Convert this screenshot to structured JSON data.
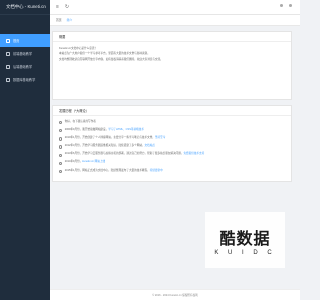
{
  "app": {
    "brand": "文档中心 - Kuneti.cn"
  },
  "sidebar": {
    "items": [
      {
        "label": "首页",
        "active": true
      },
      {
        "label": "前端基础教学"
      },
      {
        "label": "后端基础教学"
      },
      {
        "label": "数据库基础教学"
      }
    ]
  },
  "tabs": {
    "home": "首页",
    "current": "简介"
  },
  "notice": {
    "title": "概要",
    "lines": [
      "Kunetic.cn文档中心是什么意思？",
      "本站点为广大用户提供一个学习参考平台，里面有大量的技术文章与各种资源。",
      "文档均整理收录自互联网开放分享内容，如有侵权请联系我们删除，欢迎大家浏览与交流。"
    ]
  },
  "timeline": {
    "title": "发展历程（*大概论）",
    "items": [
      {
        "text": "你好，在下我认真的写作者",
        "link": ""
      },
      {
        "text": "2009年9月份，我开始接触网站建设，",
        "link": "学习了HTML、CSS等前端技术"
      },
      {
        "text": "2010年1月份，开始创建了个人博客网站，主要分享一些学习笔记与技术文章，",
        "link": "坚持至今"
      },
      {
        "text": "2012年3月份，开始学习服务器运维相关知识，陆续搭建了多个网站，",
        "link": "文档站点"
      },
      {
        "text": "2013年6月份，开始学习云服务器与虚拟主机的部署，通过自己的努力，帮助了很多站长朋友解决问题，",
        "link": "免费提供技术支持"
      },
      {
        "text": "2014年9月份，",
        "link": "kunetic.cn 网站上线"
      },
      {
        "text": "2015年1月份，网站正式成为文档中心，陆续整理发布了大量的技术教程，",
        "link": "持续更新中"
      }
    ]
  },
  "footer": {
    "text": "© 2016 - 2024 Kunetic.cn 保留所有权利"
  },
  "watermark": {
    "main": "酷数据",
    "sub": "K U I D C"
  }
}
